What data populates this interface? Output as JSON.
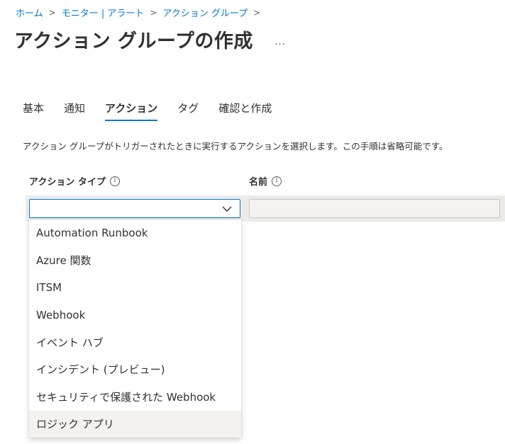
{
  "breadcrumb": [
    {
      "label": "ホーム"
    },
    {
      "label": "モニター | アラート"
    },
    {
      "label": "アクション グループ"
    }
  ],
  "breadcrumb_separator": ">",
  "page_title": "アクション グループの作成",
  "more_label": "...",
  "tabs": [
    {
      "label": "基本",
      "active": false
    },
    {
      "label": "通知",
      "active": false
    },
    {
      "label": "アクション",
      "active": true
    },
    {
      "label": "タグ",
      "active": false
    },
    {
      "label": "確認と作成",
      "active": false
    }
  ],
  "description": "アクション グループがトリガーされたときに実行するアクションを選択します。この手順は省略可能です。",
  "columns": {
    "action_type": "アクション タイプ",
    "name": "名前",
    "info_glyph": "i"
  },
  "action_type_dropdown": {
    "value": "",
    "options": [
      "Automation Runbook",
      "Azure 関数",
      "ITSM",
      "Webhook",
      "イベント ハブ",
      "インシデント (プレビュー)",
      "セキュリティで保護された Webhook",
      "ロジック アプリ"
    ],
    "highlighted_index": 7
  },
  "name_input": {
    "value": ""
  },
  "colors": {
    "accent": "#0078d4",
    "text": "#323130",
    "row_bg": "#edebe9",
    "highlight_bg": "#f3f2f1"
  }
}
